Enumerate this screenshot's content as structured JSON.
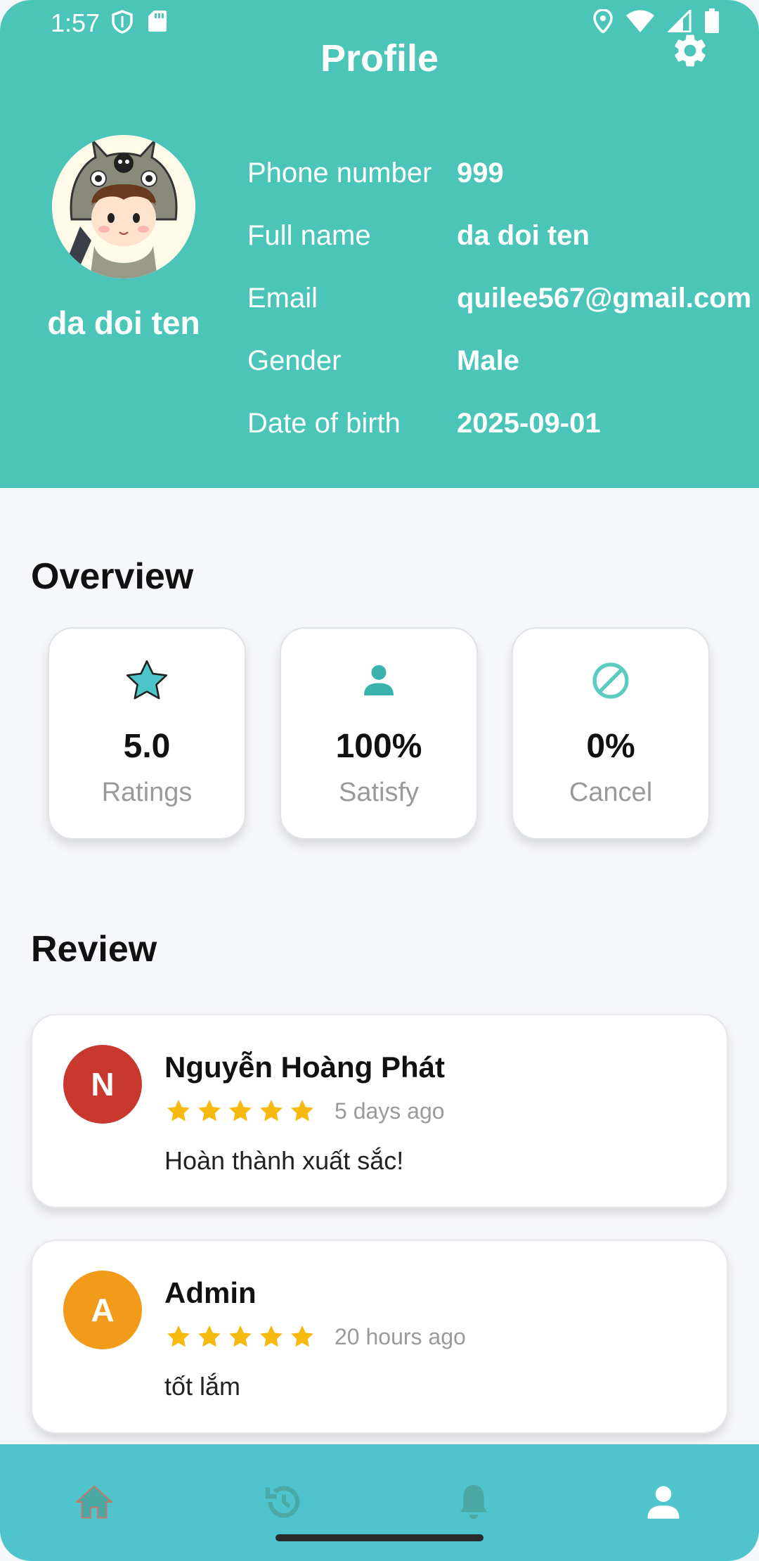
{
  "status_bar": {
    "time": "1:57"
  },
  "header": {
    "title": "Profile",
    "display_name": "da doi ten",
    "info": [
      {
        "label": "Phone number",
        "value": "999"
      },
      {
        "label": "Full name",
        "value": "da doi ten"
      },
      {
        "label": "Email",
        "value": "quilee567@gmail.com"
      },
      {
        "label": "Gender",
        "value": "Male"
      },
      {
        "label": "Date of birth",
        "value": "2025-09-01"
      }
    ]
  },
  "overview": {
    "title": "Overview",
    "stats": [
      {
        "value": "5.0",
        "label": "Ratings",
        "icon": "star-icon"
      },
      {
        "value": "100%",
        "label": "Satisfy",
        "icon": "person-icon"
      },
      {
        "value": "0%",
        "label": "Cancel",
        "icon": "cancel-icon"
      }
    ]
  },
  "review": {
    "title": "Review",
    "items": [
      {
        "initial": "N",
        "name": "Nguyễn Hoàng Phát",
        "rating": 5,
        "time": "5 days ago",
        "text": "Hoàn thành xuất sắc!",
        "avatar_color": "#c8382e"
      },
      {
        "initial": "A",
        "name": "Admin",
        "rating": 5,
        "time": "20 hours ago",
        "text": "tốt lắm",
        "avatar_color": "#f29a1a"
      }
    ]
  },
  "bottom_nav": {
    "items": [
      "home-icon",
      "history-icon",
      "bell-icon",
      "profile-icon"
    ],
    "active": "profile-icon"
  },
  "colors": {
    "primary": "#4cc5b9",
    "nav": "#4fc4cc",
    "star": "#f5b90f"
  }
}
